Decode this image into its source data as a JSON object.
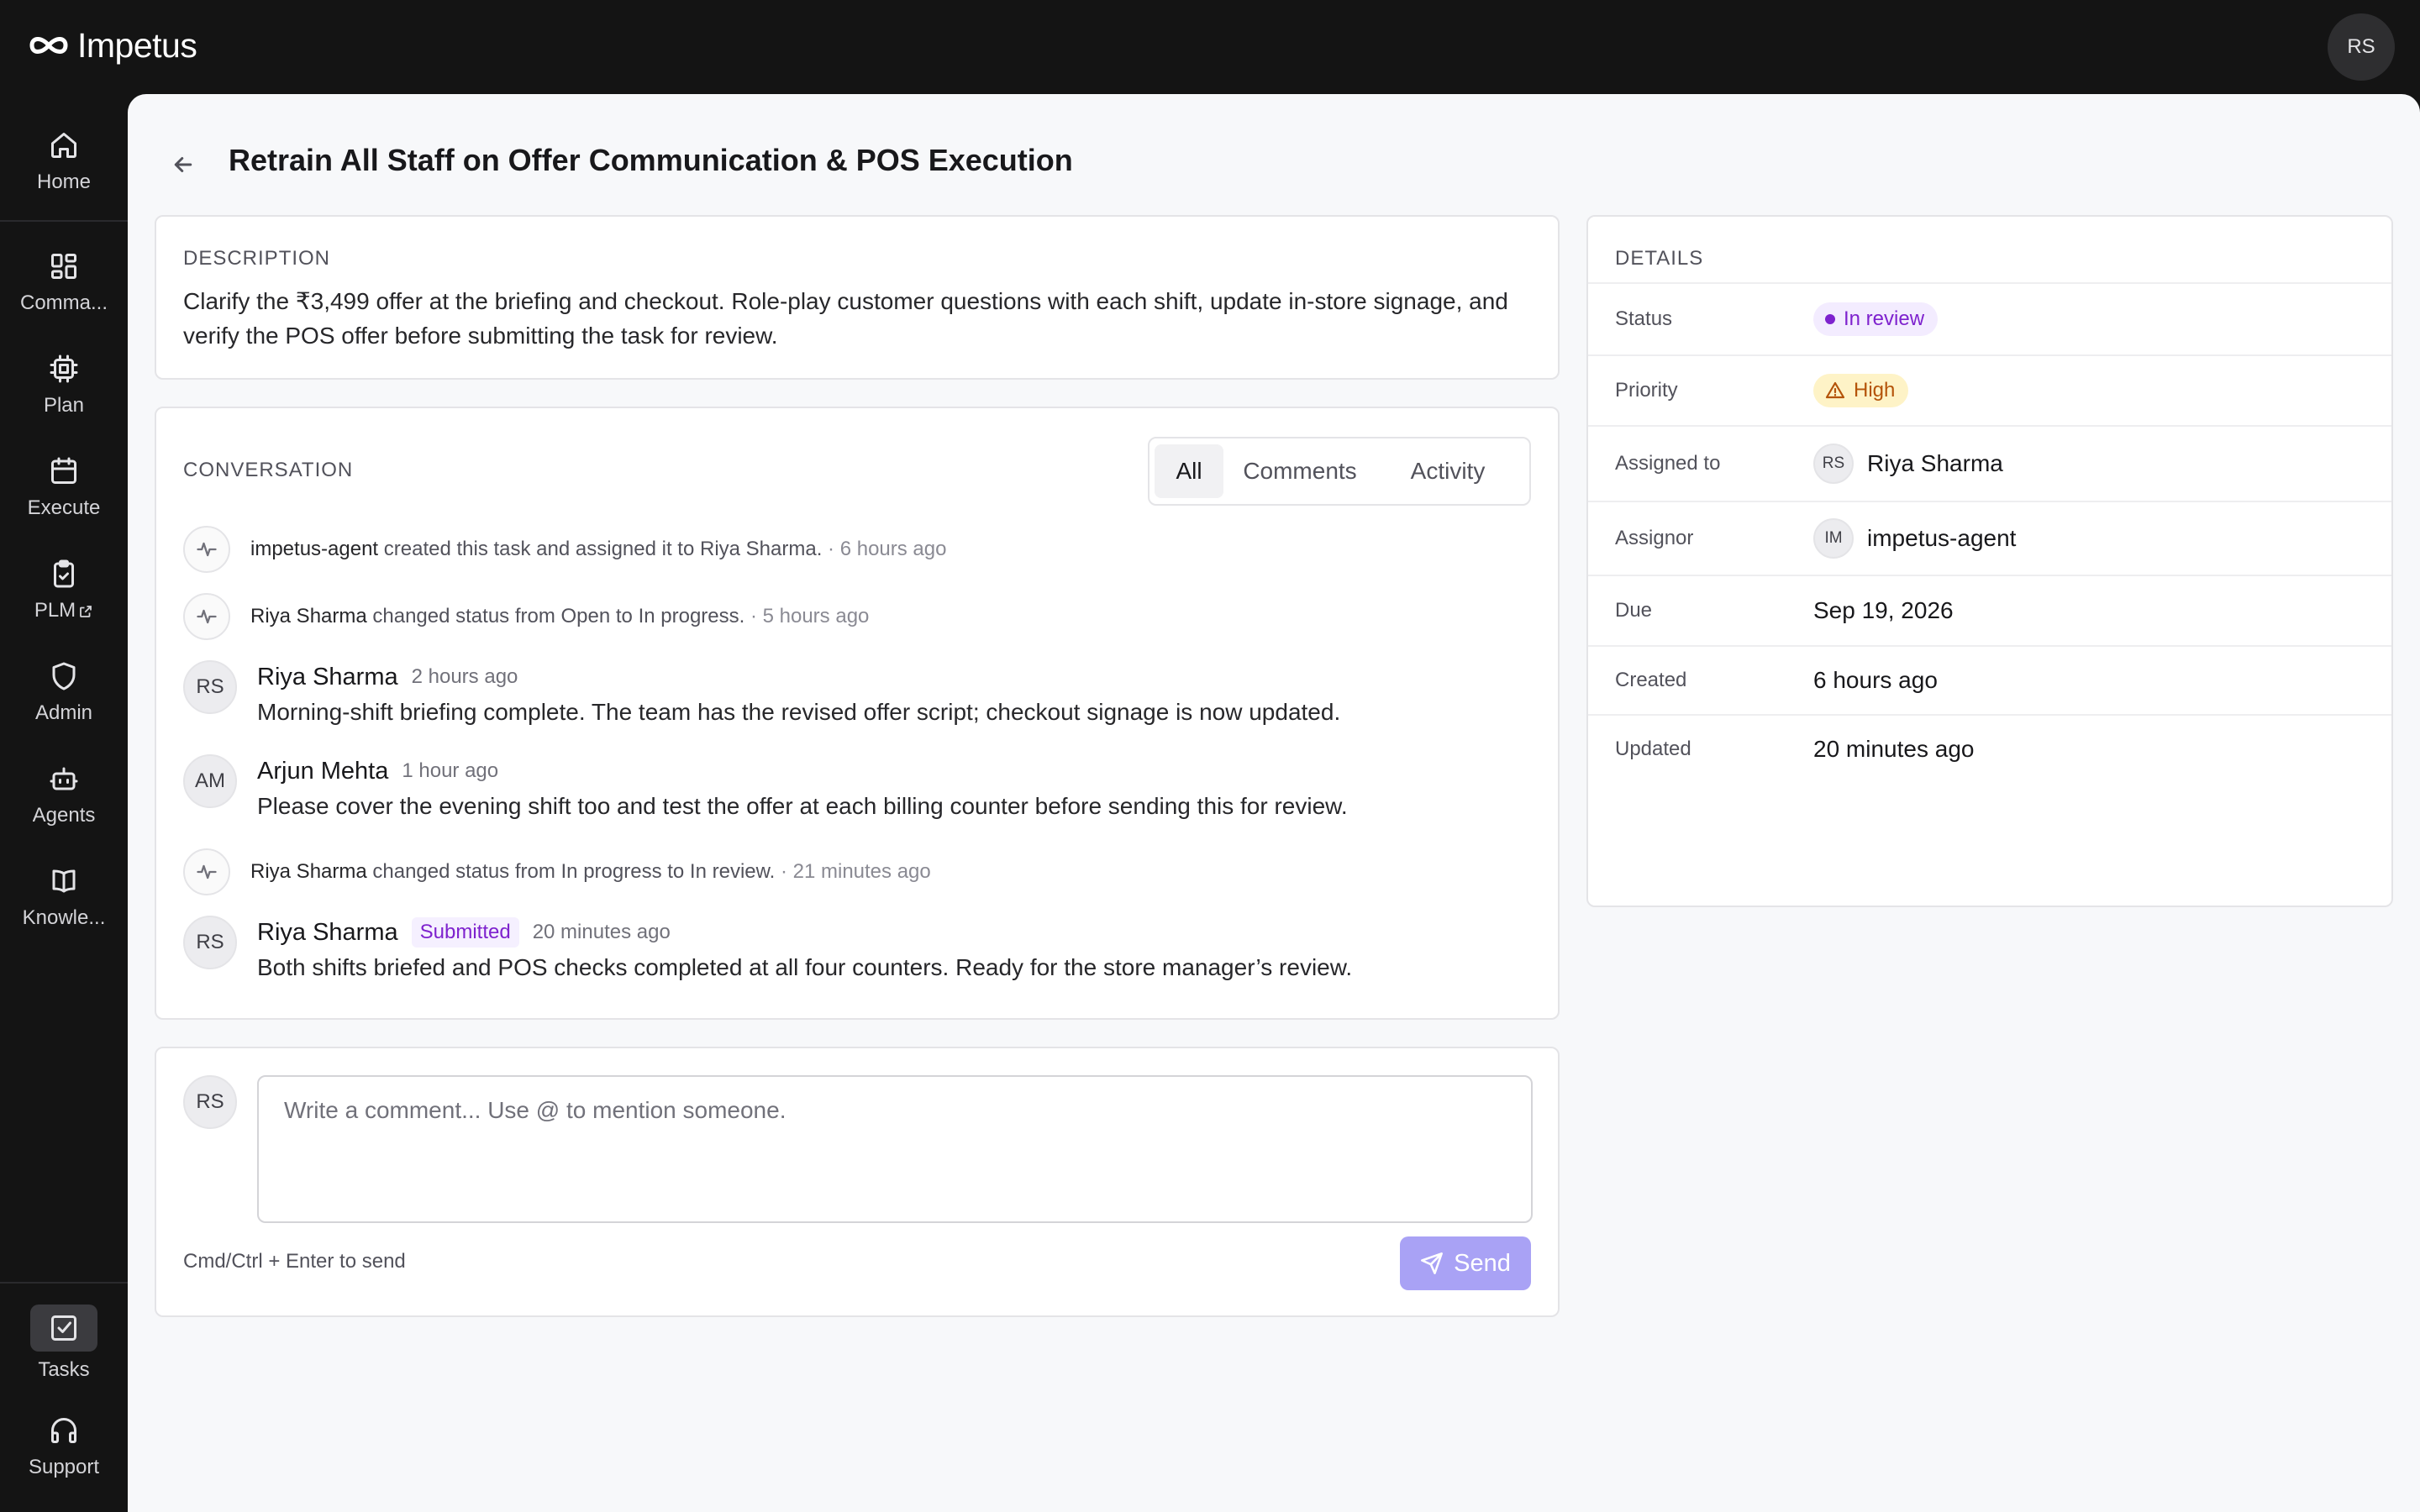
{
  "app": {
    "name": "Impetus",
    "user_initials": "RS"
  },
  "sidebar": {
    "items": [
      {
        "label": "Home",
        "icon": "home-icon"
      },
      {
        "label": "Comma...",
        "icon": "dashboard-icon"
      },
      {
        "label": "Plan",
        "icon": "cpu-icon"
      },
      {
        "label": "Execute",
        "icon": "calendar-icon"
      },
      {
        "label": "PLM",
        "icon": "clipboard-check-icon",
        "external_icon": "external-link-icon"
      },
      {
        "label": "Admin",
        "icon": "shield-icon"
      },
      {
        "label": "Agents",
        "icon": "bot-icon"
      },
      {
        "label": "Knowle...",
        "icon": "book-icon"
      }
    ],
    "bottom": [
      {
        "label": "Tasks",
        "icon": "checkbox-icon",
        "active": true
      },
      {
        "label": "Support",
        "icon": "headphones-icon"
      }
    ]
  },
  "page": {
    "title": "Retrain All Staff on Offer Communication & POS Execution"
  },
  "description": {
    "label": "DESCRIPTION",
    "text": "Clarify the ₹3,499 offer at the briefing and checkout. Role-play customer questions with each shift, update in-store signage, and verify the POS offer before submitting the task for review."
  },
  "conversation": {
    "label": "CONVERSATION",
    "tabs": [
      "All",
      "Comments",
      "Activity"
    ],
    "active_tab": "All",
    "activities": [
      {
        "actor": "impetus-agent",
        "text": " created this task and assigned it to Riya Sharma.",
        "time": " · 6 hours ago"
      },
      {
        "actor": "Riya Sharma",
        "text": " changed status from Open to In progress.",
        "time": " · 5 hours ago"
      },
      {
        "actor": "Riya Sharma",
        "text": " changed status from In progress to In review.",
        "time": " · 21 minutes ago"
      }
    ],
    "comments": [
      {
        "initials": "RS",
        "name": "Riya Sharma",
        "time": "2 hours ago",
        "body": "Morning-shift briefing complete. The team has the revised offer script; checkout signage is now updated."
      },
      {
        "initials": "AM",
        "name": "Arjun Mehta",
        "time": "1 hour ago",
        "body": "Please cover the evening shift too and test the offer at each billing counter before sending this for review."
      },
      {
        "initials": "RS",
        "name": "Riya Sharma",
        "badge": "Submitted",
        "time": "20 minutes ago",
        "body": "Both shifts briefed and POS checks completed at all four counters. Ready for the store manager’s review."
      }
    ]
  },
  "composer": {
    "initials": "RS",
    "placeholder": "Write a comment... Use @ to mention someone.",
    "value": "",
    "hint": "Cmd/Ctrl + Enter to send",
    "send_label": "Send"
  },
  "details": {
    "label": "DETAILS",
    "status": {
      "key": "Status",
      "value": "In review"
    },
    "priority": {
      "key": "Priority",
      "value": "High"
    },
    "assigned_to": {
      "key": "Assigned to",
      "initials": "RS",
      "value": "Riya Sharma"
    },
    "assignor": {
      "key": "Assignor",
      "initials": "IM",
      "value": "impetus-agent"
    },
    "due": {
      "key": "Due",
      "value": "Sep 19, 2026"
    },
    "created": {
      "key": "Created",
      "value": "6 hours ago"
    },
    "updated": {
      "key": "Updated",
      "value": "20 minutes ago"
    }
  },
  "colors": {
    "accent": "#a9a2f5",
    "status_purple": "#7e22ce",
    "priority_amber": "#b45309",
    "sidebar_bg": "#141414"
  }
}
